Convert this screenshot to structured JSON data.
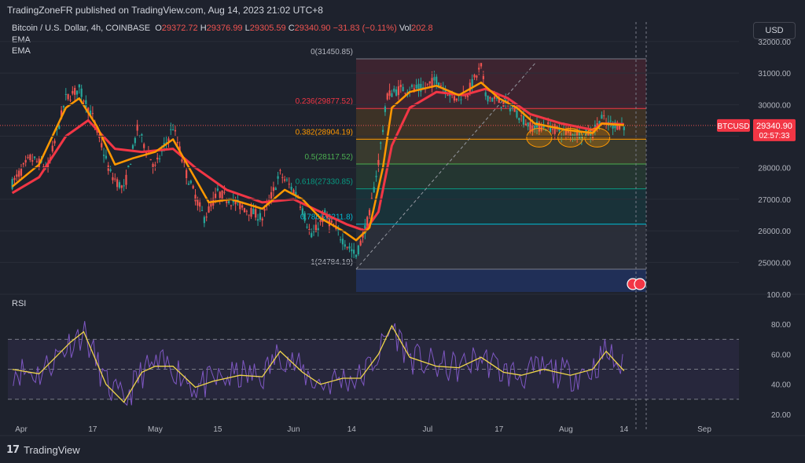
{
  "header": {
    "publisher": "TradingZoneFR published on TradingView.com, Aug 14, 2023 21:02 UTC+8"
  },
  "legend": {
    "symbol": "Bitcoin / U.S. Dollar, 4h, COINBASE",
    "o_label": "O",
    "o": "29372.72",
    "h_label": "H",
    "h": "29376.99",
    "l_label": "L",
    "l": "29305.59",
    "c_label": "C",
    "c": "29340.90",
    "change": "−31.83 (−0.11%)",
    "vol_label": "Vol",
    "vol": "202.8",
    "ema1": "EMA",
    "ema2": "EMA"
  },
  "currency_button": "USD",
  "price_tag": {
    "symbol": "BTCUSD",
    "price": "29340.90",
    "countdown": "02:57:33"
  },
  "rsi_label": "RSI",
  "brand": {
    "logo": "17",
    "name": "TradingView"
  },
  "colors": {
    "background": "#1e222d",
    "ema_fast": "#ff9800",
    "ema_slow": "#f23645",
    "rsi": "#7e57c2",
    "rsi_ma": "#f0d64a",
    "up": "#26a69a",
    "down": "#ef5350"
  },
  "chart_data": [
    {
      "type": "candlestick",
      "title": "Bitcoin / U.S. Dollar, 4h, COINBASE",
      "ylim": [
        24000,
        32400
      ],
      "y_ticks": [
        25000,
        26000,
        27000,
        28000,
        29000,
        30000,
        31000,
        32000
      ],
      "y_tick_labels": [
        "25000.00",
        "26000.00",
        "27000.00",
        "28000.00",
        "29000.00",
        "30000.00",
        "31000.00",
        "32000.00"
      ],
      "x_ticks": [
        "Apr",
        "17",
        "May",
        "15",
        "Jun",
        "14",
        "Jul",
        "17",
        "Aug",
        "14",
        "Sep"
      ],
      "price_path": [
        [
          "Mar 30",
          27500
        ],
        [
          "Apr 3",
          28300
        ],
        [
          "Apr 7",
          28000
        ],
        [
          "Apr 11",
          30200
        ],
        [
          "Apr 14",
          30500
        ],
        [
          "Apr 17",
          29600
        ],
        [
          "Apr 21",
          27800
        ],
        [
          "Apr 24",
          27300
        ],
        [
          "Apr 27",
          29200
        ],
        [
          "May 1",
          28000
        ],
        [
          "May 5",
          29300
        ],
        [
          "May 8",
          27800
        ],
        [
          "May 12",
          26400
        ],
        [
          "May 15",
          27200
        ],
        [
          "May 20",
          26800
        ],
        [
          "May 25",
          26400
        ],
        [
          "May 29",
          27800
        ],
        [
          "Jun 2",
          27100
        ],
        [
          "Jun 5",
          25800
        ],
        [
          "Jun 8",
          26500
        ],
        [
          "Jun 11",
          25900
        ],
        [
          "Jun 15",
          25200
        ],
        [
          "Jun 18",
          26500
        ],
        [
          "Jun 20",
          28200
        ],
        [
          "Jun 22",
          30300
        ],
        [
          "Jun 25",
          30500
        ],
        [
          "Jun 30",
          30500
        ],
        [
          "Jul 3",
          30800
        ],
        [
          "Jul 7",
          30200
        ],
        [
          "Jul 10",
          30400
        ],
        [
          "Jul 13",
          31200
        ],
        [
          "Jul 14",
          30300
        ],
        [
          "Jul 17",
          30100
        ],
        [
          "Jul 20",
          29900
        ],
        [
          "Jul 24",
          29300
        ],
        [
          "Jul 28",
          29300
        ],
        [
          "Aug 1",
          29100
        ],
        [
          "Aug 4",
          29100
        ],
        [
          "Aug 7",
          29100
        ],
        [
          "Aug 9",
          29600
        ],
        [
          "Aug 10",
          29400
        ],
        [
          "Aug 14",
          29340
        ]
      ],
      "ema_fast": [
        [
          "Mar 30",
          27400
        ],
        [
          "Apr 5",
          28100
        ],
        [
          "Apr 11",
          29900
        ],
        [
          "Apr 14",
          30200
        ],
        [
          "Apr 18",
          29300
        ],
        [
          "Apr 22",
          28100
        ],
        [
          "Apr 26",
          28300
        ],
        [
          "May 1",
          28500
        ],
        [
          "May 5",
          28900
        ],
        [
          "May 9",
          27900
        ],
        [
          "May 13",
          26900
        ],
        [
          "May 18",
          27000
        ],
        [
          "May 25",
          26700
        ],
        [
          "May 30",
          27300
        ],
        [
          "Jun 3",
          27000
        ],
        [
          "Jun 7",
          26400
        ],
        [
          "Jun 12",
          26000
        ],
        [
          "Jun 15",
          25700
        ],
        [
          "Jun 18",
          26100
        ],
        [
          "Jun 21",
          28000
        ],
        [
          "Jun 23",
          29900
        ],
        [
          "Jun 27",
          30400
        ],
        [
          "Jul 3",
          30600
        ],
        [
          "Jul 8",
          30300
        ],
        [
          "Jul 13",
          30700
        ],
        [
          "Jul 17",
          30200
        ],
        [
          "Jul 21",
          29900
        ],
        [
          "Jul 25",
          29400
        ],
        [
          "Aug 1",
          29200
        ],
        [
          "Aug 7",
          29100
        ],
        [
          "Aug 9",
          29400
        ],
        [
          "Aug 14",
          29350
        ]
      ],
      "ema_slow": [
        [
          "Mar 30",
          27200
        ],
        [
          "Apr 5",
          27700
        ],
        [
          "Apr 11",
          29000
        ],
        [
          "Apr 16",
          29500
        ],
        [
          "Apr 22",
          28600
        ],
        [
          "Apr 28",
          28500
        ],
        [
          "May 5",
          28600
        ],
        [
          "May 10",
          28000
        ],
        [
          "May 17",
          27300
        ],
        [
          "May 25",
          26900
        ],
        [
          "Jun 1",
          27000
        ],
        [
          "Jun 7",
          26600
        ],
        [
          "Jun 13",
          26200
        ],
        [
          "Jun 17",
          26000
        ],
        [
          "Jun 20",
          26600
        ],
        [
          "Jun 23",
          28700
        ],
        [
          "Jun 27",
          29900
        ],
        [
          "Jul 3",
          30400
        ],
        [
          "Jul 9",
          30300
        ],
        [
          "Jul 14",
          30500
        ],
        [
          "Jul 19",
          30200
        ],
        [
          "Jul 24",
          29700
        ],
        [
          "Jul 31",
          29400
        ],
        [
          "Aug 7",
          29200
        ],
        [
          "Aug 9",
          29400
        ],
        [
          "Aug 14",
          29380
        ]
      ],
      "fibonacci": {
        "from": [
          "Jun 15",
          24784.19
        ],
        "to": [
          "Jul 13",
          31450.85
        ],
        "levels": [
          {
            "ratio": "0",
            "price": "31450.85",
            "label": "0(31450.85)"
          },
          {
            "ratio": "0.236",
            "price": "29877.52",
            "label": "0.236(29877.52)"
          },
          {
            "ratio": "0.382",
            "price": "28904.19",
            "label": "0.382(28904.19)"
          },
          {
            "ratio": "0.5",
            "price": "28117.52",
            "label": "0.5(28117.52)"
          },
          {
            "ratio": "0.618",
            "price": "27330.85",
            "label": "0.618(27330.85)"
          },
          {
            "ratio": "0.786",
            "price": "26211.8",
            "label": "0.786(26211.8)"
          },
          {
            "ratio": "1",
            "price": "24784.19",
            "label": "1(24784.19)"
          }
        ]
      },
      "annotations": [
        "three circles marking support at the 0.382 level (late Jul - Aug)"
      ]
    },
    {
      "type": "line",
      "title": "RSI",
      "ylim": [
        10,
        100
      ],
      "y_ticks": [
        20,
        40,
        60,
        80,
        100
      ],
      "y_tick_labels": [
        "20.00",
        "40.00",
        "60.00",
        "80.00",
        "100.00"
      ],
      "bands": [
        30,
        50,
        70
      ],
      "rsi_ma_path": [
        [
          "Mar 30",
          50
        ],
        [
          "Apr 5",
          47
        ],
        [
          "Apr 12",
          68
        ],
        [
          "Apr 15",
          75
        ],
        [
          "Apr 20",
          40
        ],
        [
          "Apr 24",
          28
        ],
        [
          "Apr 28",
          48
        ],
        [
          "May 1",
          52
        ],
        [
          "May 5",
          52
        ],
        [
          "May 10",
          38
        ],
        [
          "May 14",
          42
        ],
        [
          "May 20",
          46
        ],
        [
          "May 25",
          45
        ],
        [
          "May 29",
          62
        ],
        [
          "Jun 3",
          48
        ],
        [
          "Jun 7",
          40
        ],
        [
          "Jun 12",
          44
        ],
        [
          "Jun 16",
          44
        ],
        [
          "Jun 20",
          60
        ],
        [
          "Jun 23",
          79
        ],
        [
          "Jun 27",
          58
        ],
        [
          "Jul 3",
          52
        ],
        [
          "Jul 8",
          51
        ],
        [
          "Jul 13",
          58
        ],
        [
          "Jul 18",
          48
        ],
        [
          "Jul 22",
          46
        ],
        [
          "Jul 27",
          50
        ],
        [
          "Aug 2",
          46
        ],
        [
          "Aug 7",
          50
        ],
        [
          "Aug 10",
          62
        ],
        [
          "Aug 14",
          49
        ]
      ]
    }
  ]
}
